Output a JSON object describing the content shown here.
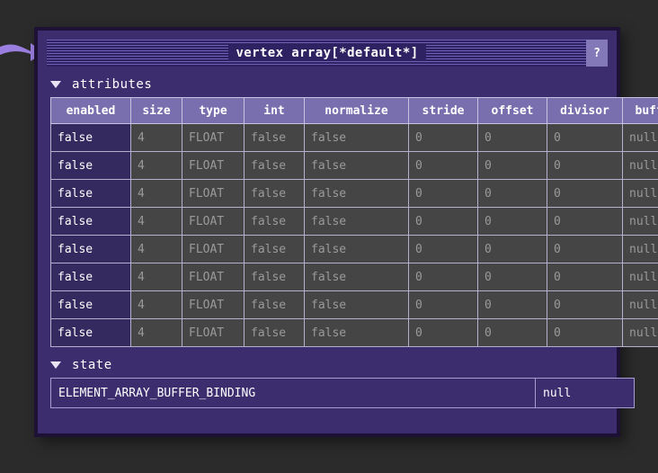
{
  "window": {
    "title": "vertex array[*default*]",
    "help_label": "?"
  },
  "sections": {
    "attributes": {
      "label": "attributes",
      "triangle": "triangle-down-icon"
    },
    "state": {
      "label": "state",
      "triangle": "triangle-down-icon"
    }
  },
  "attributes_table": {
    "columns": [
      "enabled",
      "size",
      "type",
      "int",
      "normalize",
      "stride",
      "offset",
      "divisor",
      "buffer"
    ],
    "rows": [
      [
        "false",
        "4",
        "FLOAT",
        "false",
        "false",
        "0",
        "0",
        "0",
        "null"
      ],
      [
        "false",
        "4",
        "FLOAT",
        "false",
        "false",
        "0",
        "0",
        "0",
        "null"
      ],
      [
        "false",
        "4",
        "FLOAT",
        "false",
        "false",
        "0",
        "0",
        "0",
        "null"
      ],
      [
        "false",
        "4",
        "FLOAT",
        "false",
        "false",
        "0",
        "0",
        "0",
        "null"
      ],
      [
        "false",
        "4",
        "FLOAT",
        "false",
        "false",
        "0",
        "0",
        "0",
        "null"
      ],
      [
        "false",
        "4",
        "FLOAT",
        "false",
        "false",
        "0",
        "0",
        "0",
        "null"
      ],
      [
        "false",
        "4",
        "FLOAT",
        "false",
        "false",
        "0",
        "0",
        "0",
        "null"
      ],
      [
        "false",
        "4",
        "FLOAT",
        "false",
        "false",
        "0",
        "0",
        "0",
        "null"
      ]
    ]
  },
  "state_table": {
    "rows": [
      {
        "name": "ELEMENT_ARRAY_BUFFER_BINDING",
        "value": "null"
      }
    ]
  },
  "annotation": {
    "arrow": "arrow-right-icon",
    "arrow_color": "#9b7fe0"
  },
  "colors": {
    "page_background": "#2b2b2b",
    "window_background": "#3b2d6e",
    "window_border": "#1d1136",
    "titlebar_stripe_light": "#6f5fb5",
    "titlebar_stripe_dark": "#2f2262",
    "header_cell": "#7a6fae",
    "data_cell": "#454545",
    "enabled_cell": "#352a60",
    "text_primary": "#ffffff",
    "text_muted": "#9a9a9a",
    "help_button": "#8379b8"
  }
}
